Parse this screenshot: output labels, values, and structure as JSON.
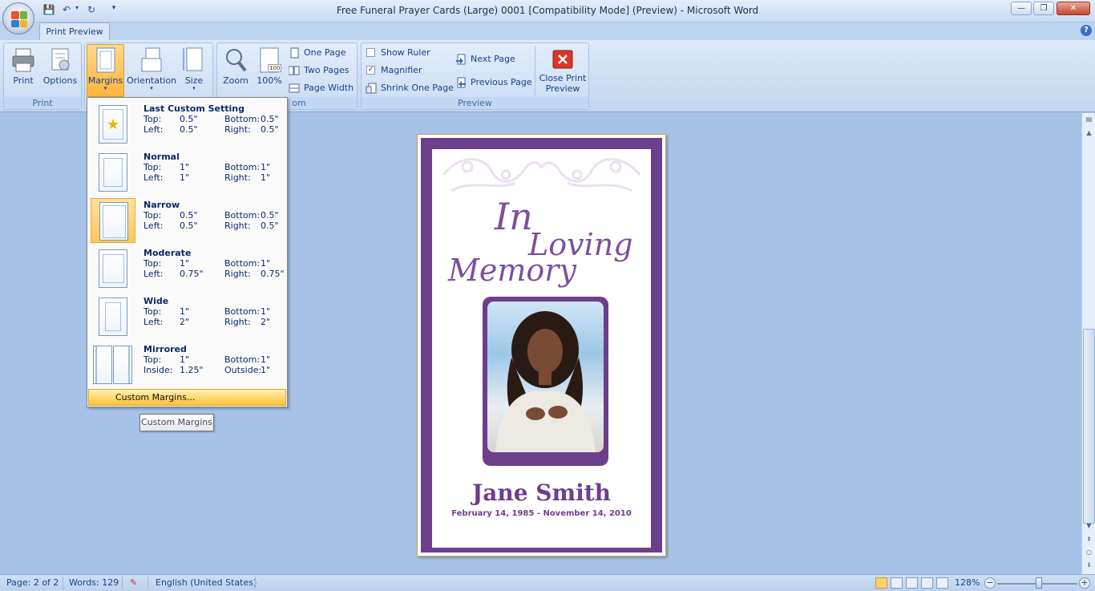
{
  "window": {
    "title": "Free Funeral Prayer Cards (Large) 0001 [Compatibility Mode] (Preview) - Microsoft Word",
    "minimize": "—",
    "restore": "❐",
    "close": "✕"
  },
  "qat": {
    "save": "💾",
    "undo": "↶",
    "redo": "↻",
    "more": "▾"
  },
  "tabs": {
    "active": "Print Preview"
  },
  "ribbon": {
    "groups": {
      "print": "Print",
      "zoom": "om",
      "preview": "Preview"
    },
    "print_btn": "Print",
    "options_btn": "Options",
    "margins_btn": "Margins",
    "orientation_btn": "Orientation",
    "size_btn": "Size",
    "zoom_btn": "Zoom",
    "hundred_btn": "100%",
    "hundred_icon_text": "100",
    "one_page": "One Page",
    "two_pages": "Two Pages",
    "page_width": "Page Width",
    "show_ruler": "Show Ruler",
    "magnifier": "Magnifier",
    "shrink_one_page": "Shrink One Page",
    "next_page": "Next Page",
    "previous_page": "Previous Page",
    "close_line1": "Close Print",
    "close_line2": "Preview",
    "show_ruler_checked": false,
    "magnifier_checked": true
  },
  "margins_menu": {
    "options": [
      {
        "title": "Last Custom Setting",
        "k1": "Top:",
        "v1": "0.5\"",
        "k2": "Bottom:",
        "v2": "0.5\"",
        "k3": "Left:",
        "v3": "0.5\"",
        "k4": "Right:",
        "v4": "0.5\""
      },
      {
        "title": "Normal",
        "k1": "Top:",
        "v1": "1\"",
        "k2": "Bottom:",
        "v2": "1\"",
        "k3": "Left:",
        "v3": "1\"",
        "k4": "Right:",
        "v4": "1\""
      },
      {
        "title": "Narrow",
        "k1": "Top:",
        "v1": "0.5\"",
        "k2": "Bottom:",
        "v2": "0.5\"",
        "k3": "Left:",
        "v3": "0.5\"",
        "k4": "Right:",
        "v4": "0.5\""
      },
      {
        "title": "Moderate",
        "k1": "Top:",
        "v1": "1\"",
        "k2": "Bottom:",
        "v2": "1\"",
        "k3": "Left:",
        "v3": "0.75\"",
        "k4": "Right:",
        "v4": "0.75\""
      },
      {
        "title": "Wide",
        "k1": "Top:",
        "v1": "1\"",
        "k2": "Bottom:",
        "v2": "1\"",
        "k3": "Left:",
        "v3": "2\"",
        "k4": "Right:",
        "v4": "2\""
      },
      {
        "title": "Mirrored",
        "k1": "Top:",
        "v1": "1\"",
        "k2": "Bottom:",
        "v2": "1\"",
        "k3": "Inside:",
        "v3": "1.25\"",
        "k4": "Outside:",
        "v4": "1\""
      }
    ],
    "selected": "Narrow",
    "custom": "Custom Margins...",
    "tooltip": "Custom Margins"
  },
  "document": {
    "heading_line1": "In",
    "heading_line2": "Loving",
    "heading_line3": "Memory",
    "name": "Jane Smith",
    "dates": "February 14, 1985 - November 14, 2010",
    "accent": "#6d3e8c"
  },
  "status": {
    "page": "Page: 2 of 2",
    "words": "Words: 129",
    "language": "English (United States)",
    "zoom": "128%",
    "zoom_minus": "−",
    "zoom_plus": "+"
  },
  "scrollbar": {
    "up": "▲",
    "down": "▼",
    "prev": "⇞",
    "select": "○",
    "next": "⇟"
  }
}
